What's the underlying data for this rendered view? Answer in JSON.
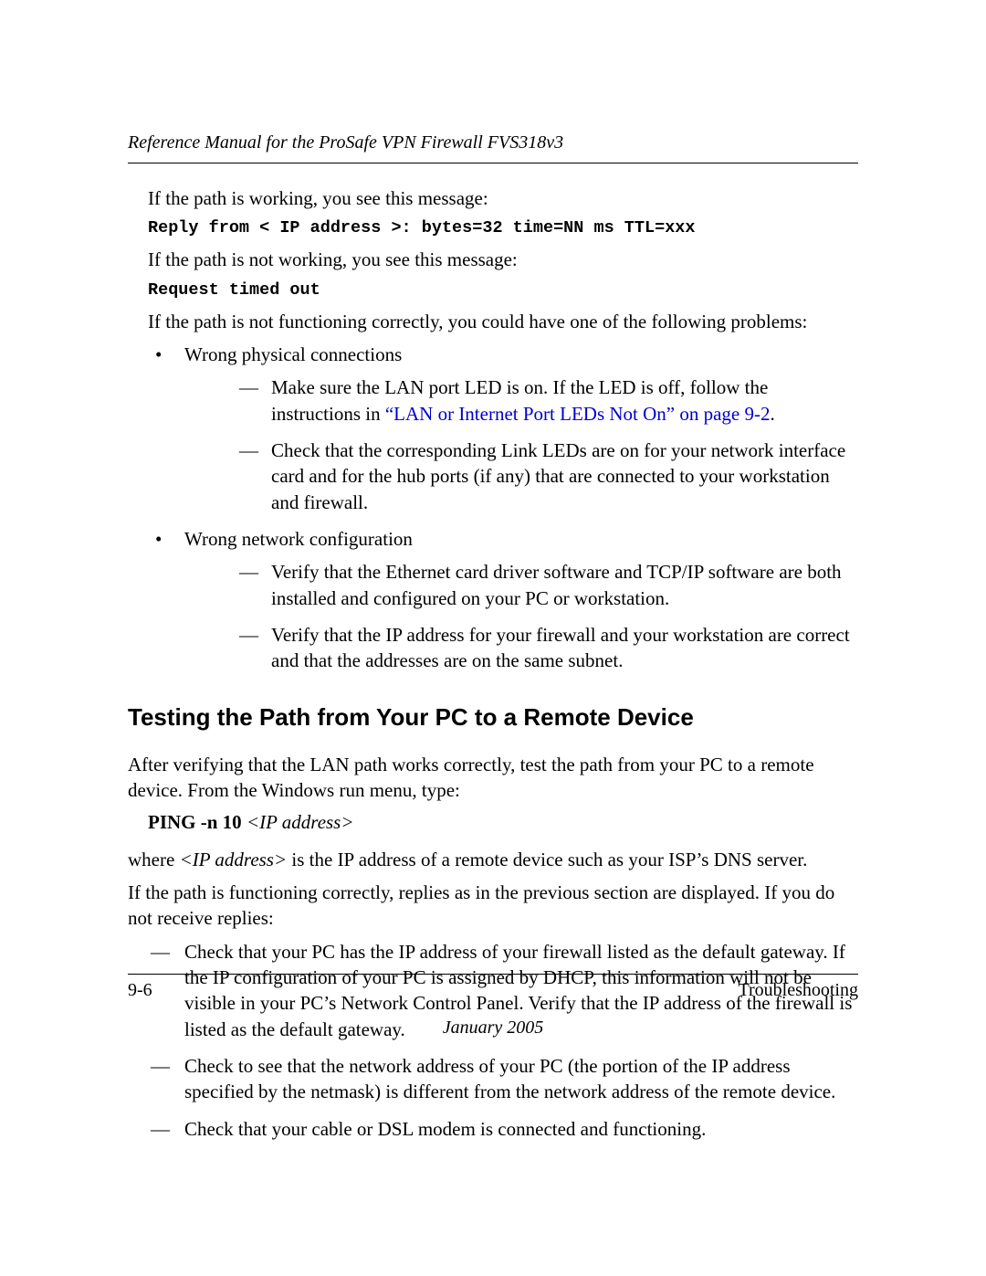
{
  "header": {
    "running": "Reference Manual for the ProSafe VPN Firewall FVS318v3"
  },
  "intro": {
    "p1": "If the path is working, you see this message:",
    "mono1": "Reply from < IP address >: bytes=32 time=NN ms TTL=xxx",
    "p2": "If the path is not working, you see this message:",
    "mono2": "Request timed out",
    "p3": "If the path is not functioning correctly, you could have one of the following problems:"
  },
  "bullets": {
    "b1": "Wrong physical connections",
    "b1d1_a": "Make sure the LAN port LED is on. If the LED is off, follow the instructions in ",
    "b1d1_link": "“LAN or Internet Port LEDs Not On” on page 9-2",
    "b1d1_c": "”.",
    "b1d2": "Check that the corresponding Link LEDs are on for your network interface card and for the hub ports (if any) that are connected to your workstation and firewall.",
    "b2": "Wrong network configuration",
    "b2d1": "Verify that the Ethernet card driver software and TCP/IP software are both installed and configured on your PC or workstation.",
    "b2d2": "Verify that the IP address for your firewall and your workstation are correct and that the addresses are on the same subnet."
  },
  "section": {
    "heading": "Testing the Path from Your PC to a Remote Device",
    "p1": "After verifying that the LAN path works correctly, test the path from your PC to a remote device. From the Windows run menu, type:",
    "cmd_bold": "PING -n 10 ",
    "cmd_ital": "<IP address>",
    "p2_a": "where ",
    "p2_ital": "<IP address>",
    "p2_b": " is the IP address of a remote device such as your ISP’s DNS server.",
    "p3": "If the path is functioning correctly, replies as in the previous section are displayed. If you do not receive replies:",
    "d1": "Check that your PC has the IP address of your firewall listed as the default gateway. If the IP configuration of your PC is assigned by DHCP, this information will not be visible in your PC’s Network Control Panel. Verify that the IP address of the firewall is listed as the default gateway.",
    "d2": "Check to see that the network address of your PC (the portion of the IP address specified by the netmask) is different from the network address of the remote device.",
    "d3": "Check that your cable or DSL modem is connected and functioning."
  },
  "footer": {
    "page": "9-6",
    "section": "Troubleshooting",
    "date": "January 2005"
  }
}
